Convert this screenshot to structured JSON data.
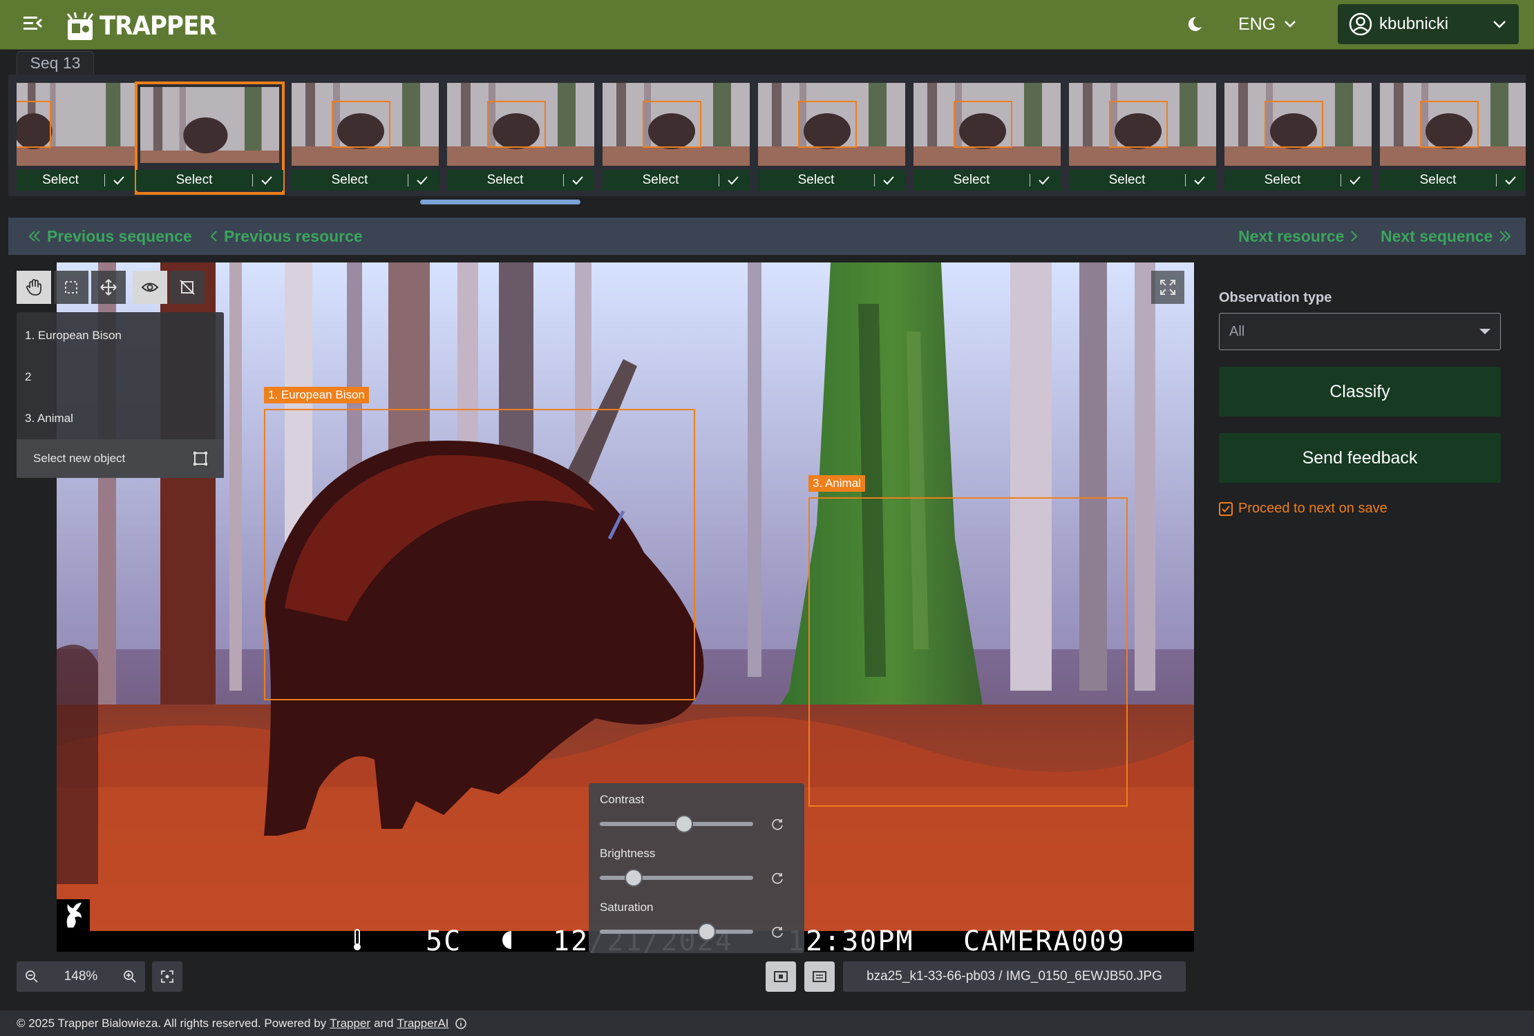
{
  "header": {
    "brand": "TRAPPER",
    "language": "ENG",
    "username": "kbubnicki"
  },
  "sequence": {
    "tab_label": "Seq 13",
    "thumbnails": [
      {
        "select_label": "Select"
      },
      {
        "select_label": "Select"
      },
      {
        "select_label": "Select"
      },
      {
        "select_label": "Select"
      },
      {
        "select_label": "Select"
      },
      {
        "select_label": "Select"
      },
      {
        "select_label": "Select"
      },
      {
        "select_label": "Select"
      },
      {
        "select_label": "Select"
      },
      {
        "select_label": "Select"
      }
    ],
    "active_index": 1
  },
  "navigation": {
    "previous_sequence": "Previous sequence",
    "previous_resource": "Previous resource",
    "next_resource": "Next resource",
    "next_sequence": "Next sequence"
  },
  "viewer": {
    "objects": [
      {
        "label": "1. European Bison"
      },
      {
        "label": "2"
      },
      {
        "label": "3. Animal"
      }
    ],
    "select_new_object": "Select new object",
    "boxes": [
      {
        "label": "1. European Bison"
      },
      {
        "label": "3. Animal"
      }
    ],
    "osd": {
      "temperature": "5C",
      "date": "12/21/2024",
      "time": "12:30PM",
      "camera": "CAMERA009"
    },
    "adjustments": [
      {
        "label": "Contrast",
        "value": 0.55
      },
      {
        "label": "Brightness",
        "value": 0.22
      },
      {
        "label": "Saturation",
        "value": 0.7
      }
    ],
    "zoom": "148%",
    "filename": "bza25_k1-33-66-pb03 / IMG_0150_6EWJB50.JPG"
  },
  "sidebar": {
    "observation_type_label": "Observation type",
    "observation_type_value": "All",
    "classify_label": "Classify",
    "feedback_label": "Send feedback",
    "proceed_label": "Proceed to next on save",
    "proceed_checked": true
  },
  "footer": {
    "text": "© 2025 Trapper Bialowieza. All rights reserved. Powered by",
    "link1": "Trapper",
    "and": "and",
    "link2": "TrapperAI"
  },
  "colors": {
    "header_bg": "#5e7a32",
    "accent_orange": "#ef7f1a",
    "nav_green": "#3ba55c",
    "button_dark_green": "#163a22"
  }
}
